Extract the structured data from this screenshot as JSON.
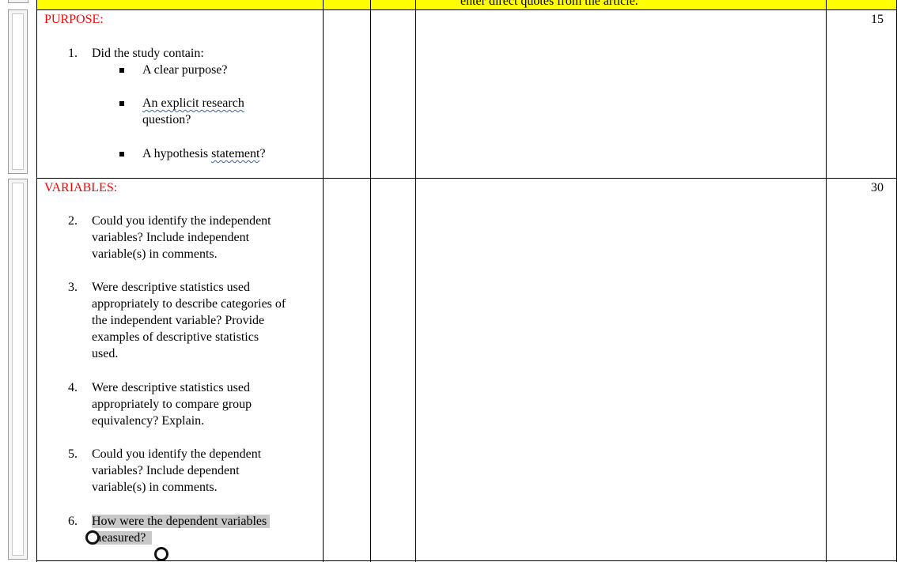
{
  "header": {
    "text": "enter direct quotes from the article."
  },
  "purpose": {
    "label": "PURPOSE:",
    "score": "15",
    "question_number": "1.",
    "question_text": "Did the study contain:",
    "bullets": [
      {
        "text": "A clear purpose?"
      },
      {
        "text_part1": "An explicit research",
        "text_part2": "question?"
      },
      {
        "text_prefix": "A hypothesis ",
        "text_underlined": "statement",
        "text_suffix": "?"
      }
    ]
  },
  "variables": {
    "label": "VARIABLES:",
    "score": "30",
    "questions": [
      {
        "number": "2.",
        "lines": [
          "Could you identify the independent",
          "variables? Include independent",
          "variable(s) in comments."
        ]
      },
      {
        "number": "3.",
        "lines": [
          "Were descriptive statistics used",
          "appropriately to describe categories of",
          "the independent variable? Provide",
          "examples of descriptive statistics",
          "used."
        ]
      },
      {
        "number": "4.",
        "lines": [
          "Were descriptive statistics used",
          "appropriately to compare group",
          "equivalency? Explain."
        ]
      },
      {
        "number": "5.",
        "lines": [
          "Could you identify the dependent",
          "variables? Include dependent",
          "variable(s) in comments."
        ]
      },
      {
        "number": "6.",
        "lines": [
          "How were the dependent variables",
          "measured?"
        ]
      }
    ]
  }
}
